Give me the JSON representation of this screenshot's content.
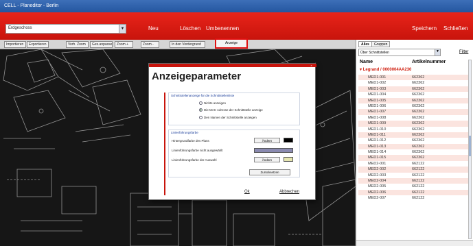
{
  "window": {
    "title": "CELL - Planeditor - Berlin"
  },
  "header": {
    "floor_select": "Erdgeschoss",
    "buttons": {
      "new": "Neu",
      "delete": "Löschen",
      "rename": "Umbenennen",
      "save": "Speichern",
      "close": "Schließen"
    }
  },
  "toolbar": {
    "import": "Importieren",
    "export": "Exportieren",
    "zoom_all": "Vorh. Zoom",
    "zoom_view": "Ges.anpassen",
    "zoom_in": "Zoom +",
    "zoom_out": "Zoom -",
    "to_foreground": "In den Vordergrund",
    "display": "Anzeige"
  },
  "panel": {
    "tabs": [
      "Alles",
      "Gruppen"
    ],
    "filter_select": "Über Schnittstellen",
    "filter_link": "Filter",
    "columns": {
      "name": "Name",
      "article": "Artikelnummer"
    },
    "group": "Legrand / 0000004AA230",
    "rows": [
      {
        "name": "MED1-001",
        "article": "662362"
      },
      {
        "name": "MED1-002",
        "article": "662362"
      },
      {
        "name": "MED1-003",
        "article": "662362"
      },
      {
        "name": "MED1-004",
        "article": "662362"
      },
      {
        "name": "MED1-005",
        "article": "662362"
      },
      {
        "name": "MED1-006",
        "article": "662362"
      },
      {
        "name": "MED1-007",
        "article": "662362"
      },
      {
        "name": "MED1-008",
        "article": "662362"
      },
      {
        "name": "MED1-009",
        "article": "662362"
      },
      {
        "name": "MED1-010",
        "article": "662362"
      },
      {
        "name": "MED1-011",
        "article": "662362"
      },
      {
        "name": "MED1-012",
        "article": "662362"
      },
      {
        "name": "MED1-013",
        "article": "662362"
      },
      {
        "name": "MED1-014",
        "article": "662362"
      },
      {
        "name": "MED1-015",
        "article": "662362"
      },
      {
        "name": "MED2-001",
        "article": "662122"
      },
      {
        "name": "MED2-002",
        "article": "662122"
      },
      {
        "name": "MED2-003",
        "article": "662122"
      },
      {
        "name": "MED2-004",
        "article": "662122"
      },
      {
        "name": "MED2-005",
        "article": "662122"
      },
      {
        "name": "MED2-006",
        "article": "662122"
      },
      {
        "name": "MED2-007",
        "article": "662122"
      }
    ]
  },
  "dialog": {
    "title": "Anzeigeparameter",
    "interface_section": "Schnittstellenanzeige für die Schnittstellenliste",
    "radio_none": "Nichts anzeigen",
    "radio_mac": "Die MAC Adresse der Schnittstelle anzeige",
    "radio_name": "Den Namen der Schnittstelle anzeigen",
    "line_section": "Linienführungsfarbe",
    "bg_color": "Hintergrundfarbe des Plans",
    "line_not_selected": "Linienführungsfarbe nicht ausgewählt",
    "line_selected": "Linienführungsfarbe der Auswahl",
    "change": "Ändern",
    "reset": "Zurücksetzen",
    "ok": "Ok",
    "cancel": "Abbrechen"
  },
  "colors": {
    "brand_red": "#c8140c",
    "canvas": "#161616",
    "line_color": "#8a8ab0",
    "selection_color": "#e6e6b0"
  }
}
